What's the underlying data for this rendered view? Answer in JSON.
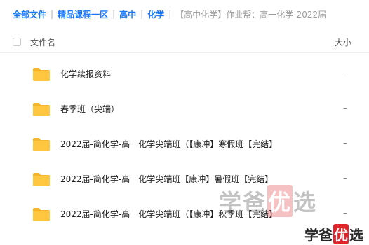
{
  "breadcrumb": {
    "items": [
      "全部文件",
      "精品课程一区",
      "高中",
      "化学"
    ],
    "separator": "|",
    "current": "【高中化学】作业帮：高一化学-2022届"
  },
  "list_header": {
    "name_label": "文件名",
    "size_label": "大小"
  },
  "files": [
    {
      "name": "化学续报资料",
      "size": "–",
      "icon": "folder-icon"
    },
    {
      "name": "春季班（尖端）",
      "size": "–",
      "icon": "folder-icon"
    },
    {
      "name": "2022届-简化学-高一化学尖端班（【康冲】寒假班【完结】",
      "size": "–",
      "icon": "folder-icon"
    },
    {
      "name": "2022届-简化学-高一化学尖端班【康冲】暑假班【完结】",
      "size": "–",
      "icon": "folder-icon"
    },
    {
      "name": "2022届-简化学-高一化学尖端班（【康冲】秋季班【完结】",
      "size": "–",
      "icon": "folder-icon"
    }
  ],
  "watermark": {
    "text": [
      "学",
      "爸",
      "优",
      "选"
    ]
  },
  "colors": {
    "link": "#1677ff",
    "folder_body": "#ffc63f",
    "folder_tab": "#f5b52b",
    "watermark_red": "#e0262c"
  }
}
